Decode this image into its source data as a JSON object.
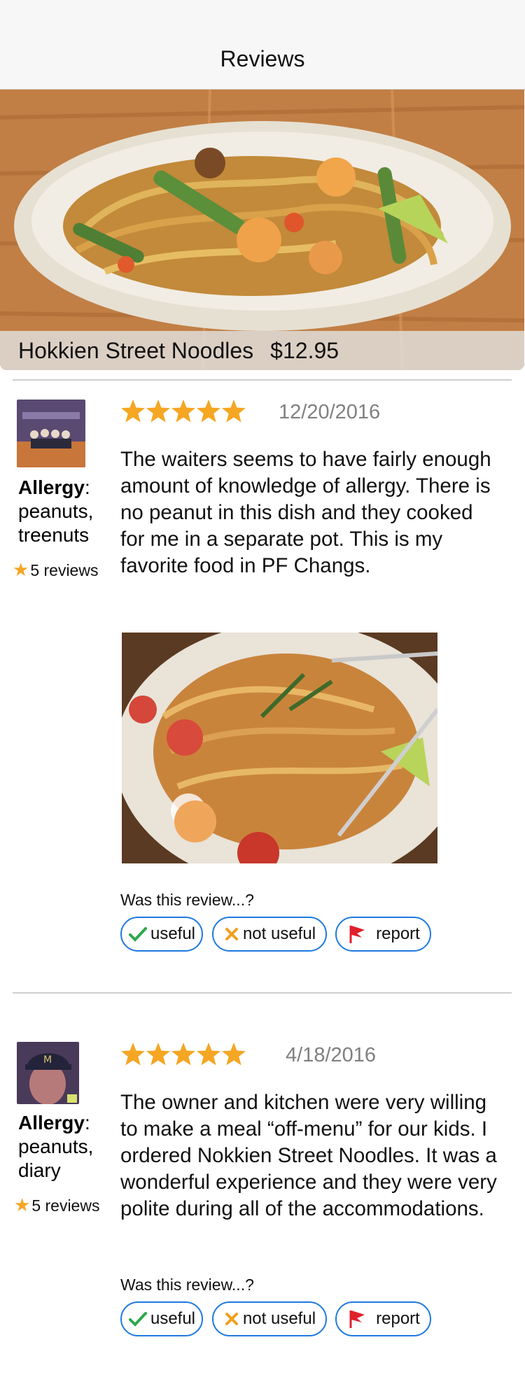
{
  "nav": {
    "title": "Reviews"
  },
  "dish": {
    "name": "Hokkien Street Noodles",
    "price": "$12.95"
  },
  "reviews": [
    {
      "rating": 5,
      "date": "12/20/2016",
      "allergy_label": "Allergy",
      "allergy_items": "peanuts, treenuts",
      "review_count": "5 reviews",
      "text": "The waiters seems to have fairly enough amount of knowledge of allergy. There is no peanut in this dish and they cooked for me in a separate pot. This is my favorite food in PF Changs.",
      "has_photo": true,
      "question": "Was this review...?",
      "useful_label": "useful",
      "not_useful_label": "not useful",
      "report_label": "report"
    },
    {
      "rating": 5,
      "date": "4/18/2016",
      "allergy_label": "Allergy",
      "allergy_items": "peanuts, diary",
      "review_count": "5 reviews",
      "text": "The owner and kitchen were very willing to make a meal “off-menu” for our kids. I ordered Nokkien Street Noodles. It was a wonderful experience and they were very polite during all of the accommodations.",
      "has_photo": false,
      "question": "Was this review...?",
      "useful_label": "useful",
      "not_useful_label": "not useful",
      "report_label": "report"
    }
  ],
  "colors": {
    "star": "#f5a623",
    "button_border": "#1e7ae0",
    "check": "#2ca84a",
    "cross": "#f0a020",
    "flag": "#e0202a"
  },
  "icons": {
    "star": "star-icon",
    "useful": "check-icon",
    "not_useful": "x-icon",
    "report": "flag-icon"
  }
}
